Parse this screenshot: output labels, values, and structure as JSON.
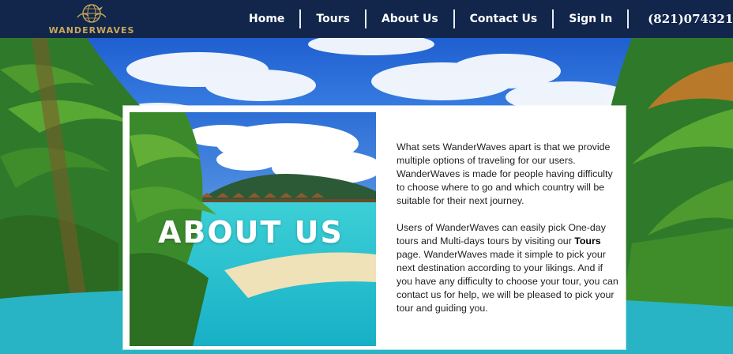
{
  "brand": {
    "name": "WANDERWAVES"
  },
  "nav": {
    "items": [
      {
        "label": "Home"
      },
      {
        "label": "Tours"
      },
      {
        "label": "About Us"
      },
      {
        "label": "Contact Us"
      },
      {
        "label": "Sign In"
      }
    ],
    "phone": "(821)074321"
  },
  "about": {
    "title": "ABOUT US",
    "paragraph1": "What sets WanderWaves apart is that we provide multiple options of traveling for our users. WanderWaves is made for people having difficulty to choose where to go and which country will be suitable for their next journey.",
    "paragraph2_before": "Users of WanderWaves can easily pick One-day tours and Multi-days tours by visiting our ",
    "paragraph2_link": "Tours",
    "paragraph2_after": " page. WanderWaves made it simple to pick your next destination according to your likings. And if you have any difficulty to choose your tour, you can contact us for help, we will be pleased to pick your tour and guiding you."
  },
  "colors": {
    "navbar_bg": "#11264a",
    "brand_gold": "#c9a85a",
    "nav_text": "#ffffff"
  }
}
